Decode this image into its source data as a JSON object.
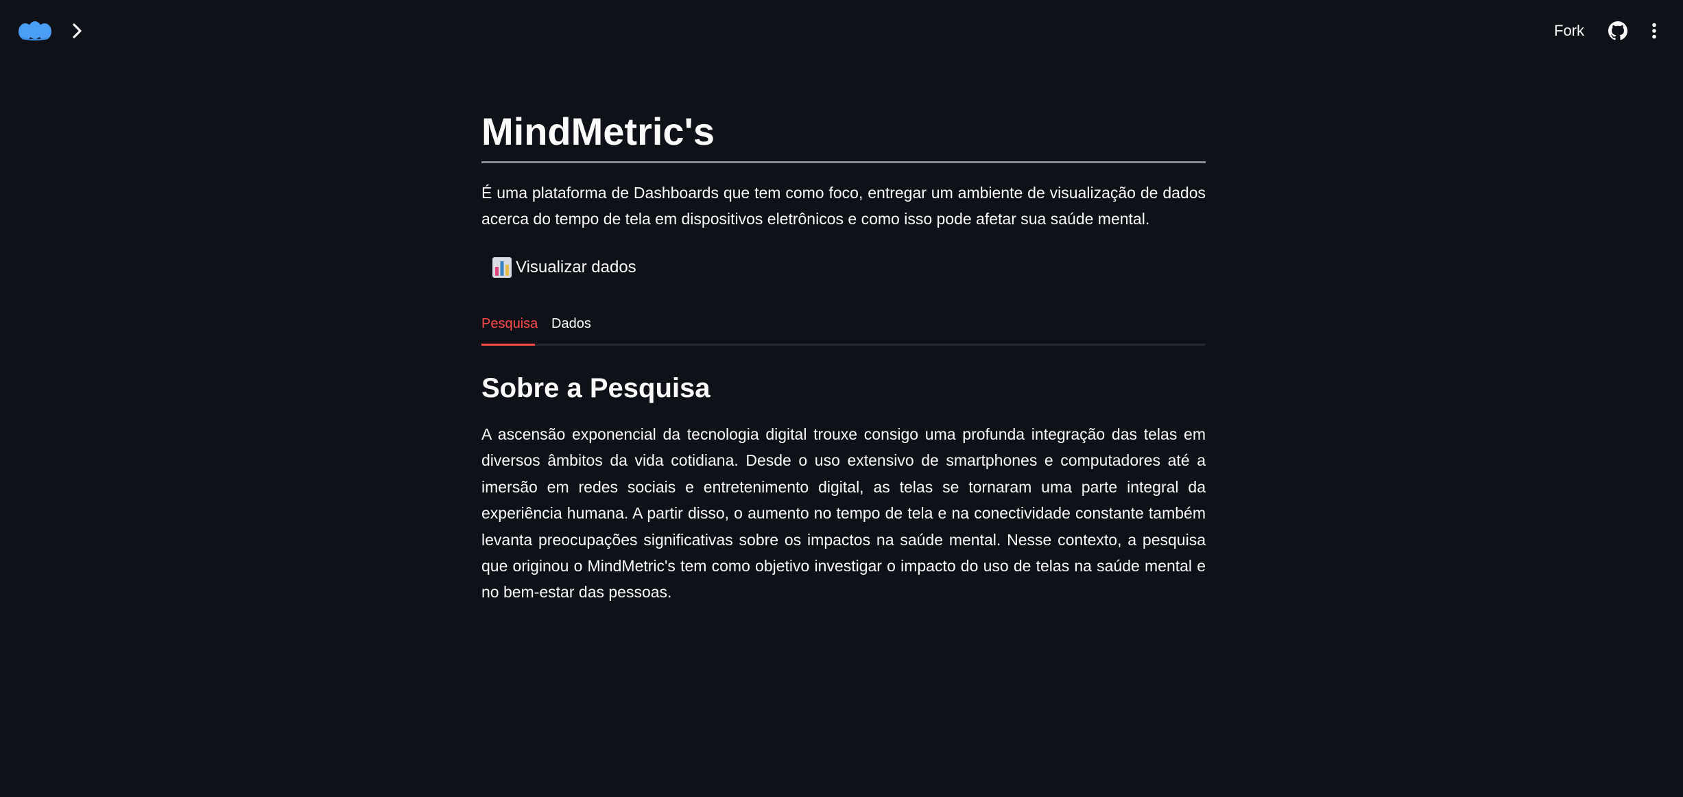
{
  "header": {
    "logo_icon": "streamlit-logo-icon",
    "sidebar_toggle_icon": "chevron-right-icon",
    "fork_label": "Fork",
    "github_icon": "github-icon",
    "menu_icon": "more-vertical-icon"
  },
  "main": {
    "title": "MindMetric's",
    "intro": "É uma plataforma de Dashboards que tem como foco, entregar um ambiente de visualização de dados acerca do tempo de tela em dispositivos eletrônicos e como isso pode afetar sua saúde mental.",
    "nav_link": {
      "icon": "bar-chart-icon",
      "label": "Visualizar dados"
    },
    "tabs": [
      {
        "label": "Pesquisa",
        "active": true
      },
      {
        "label": "Dados",
        "active": false
      }
    ],
    "section_heading": "Sobre a Pesquisa",
    "body_text": "A ascensão exponencial da tecnologia digital trouxe consigo uma profunda integração das telas em diversos âmbitos da vida cotidiana. Desde o uso extensivo de smartphones e computadores até a imersão em redes sociais e entretenimento digital, as telas se tornaram uma parte integral da experiência humana. A partir disso, o aumento no tempo de tela e na conectividade constante também levanta preocupações significativas sobre os impactos na saúde mental. Nesse contexto, a pesquisa que originou o MindMetric's tem como objetivo investigar o impacto do uso de telas na saúde mental e no bem-estar das pessoas."
  },
  "colors": {
    "background": "#0e1117",
    "text": "#fafafa",
    "accent": "#ff4b4b",
    "logo_blue": "#4a9ff5",
    "divider": "#8b8d93"
  }
}
